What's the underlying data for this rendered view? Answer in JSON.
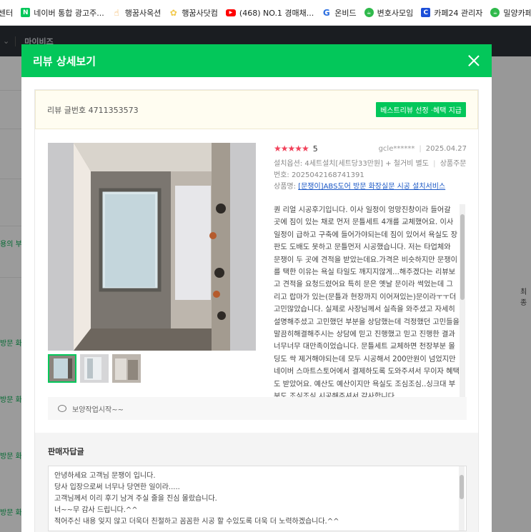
{
  "bookmarks": [
    {
      "label": "센터",
      "icon": "",
      "color": ""
    },
    {
      "label": "네이버 통합 광고주...",
      "icon": "naver-n-icon",
      "color": "#03c75a"
    },
    {
      "label": "행꿈사옥션",
      "icon": "hand-icon",
      "color": "#f0a030"
    },
    {
      "label": "행꿈사닷컴",
      "icon": "flower-icon",
      "color": "#f2c94c"
    },
    {
      "label": "(468) NO.1 경매채...",
      "icon": "youtube-icon",
      "color": "#ff0000"
    },
    {
      "label": "온비드",
      "icon": "onbid-g-icon",
      "color": "#2d6fe0"
    },
    {
      "label": "변호사모임",
      "icon": "cafe-icon",
      "color": "#2fb94b"
    },
    {
      "label": "카페24 관리자",
      "icon": "cafe24-c-icon",
      "color": "#1c4fd8"
    },
    {
      "label": "밀양카페",
      "icon": "cafe-icon",
      "color": "#2fb94b"
    }
  ],
  "background": {
    "nav_label": "마이비즈",
    "green_link": "용의 부",
    "col_header": "최종",
    "row_links": [
      "방문 화",
      "방문 화",
      "방문 화",
      "방문 화"
    ]
  },
  "modal": {
    "title": "리뷰 상세보기",
    "review_number": "리뷰 글번호 4711353573",
    "best_review_button": "베스트리뷰 선정 ·혜택 지급",
    "rating": {
      "stars": "★★★★★",
      "score": "5"
    },
    "user": "gcle******",
    "date": "2025.04.27",
    "option_line": "설치옵션: 4세트설치[세트당33만원] + 철거비 별도",
    "order_label": "상품주문",
    "order_number": "번호: 2025042168741391",
    "product_label": "상품명:",
    "product_name": "[문쟁이]ABS도어 방문 화장실문 시공 설치서비스",
    "review_text": "퀀 리얼 시공후기입니다. 이사 일정이 엉망진창이라 들어갈 곳에 짐이 있는 채로 먼저 문틀세트 4개를 교체했어요. 이사일정이 급하고 구축에 들어가야되는데 짐이 있어서 욕실도 장판도 도배도 못하고 문틀먼저 시공했습니다. 저는 타업체와 문쟁이 두 곳에 견적을 받았는데요.가격은 비슷하지만 문쟁이를 택한 이유는 욕실 타일도 깨지지않게...해주겠다는 리뷰보고 견적을 요청드렸어요 특히 문은 옛날 문이라 썩었는데 그리고 랍마가 있는(문틀과 현장까지 이어져있는)문이라ㅜㅜ더 고민많았습니다. 실제로 사장님께서 실측을 와주셨고 자세히 설명해주셨고 고민했던 부분을 상담했는데 걱정했던 고민들을 말끔히해결해주시는 상담에 믿고 진행했고 믿고 진행한 결과 너무너무 대만족이었습니다. 문틀세트 교체하면 천장부분 몰딩도 싹 제거해야되는데 모두 시공해서 200만원이 넘었지만 네이버 스마트스토어에서 결제하도록 도와주셔서 무이자 혜택도 받았어요. 예산도 예산이지만 욕실도 조심조심..싱크대 부분도 조심조심 시공해주셔서 감사합니다",
    "comment": "보양작업시작~~",
    "seller_title": "판매자답글",
    "seller_reply": [
      "안녕하세요 고객님 문쟁이 입니다.",
      "당사 입장으로써 너무나 당연한 일이라.....",
      "고객님께서 이리 후기 남겨 주실 줄을 진심 몰랐습니다.",
      "너~~무 감사 드립니다.^^",
      "적어주신 내용 잊지 않고 더욱더 친절하고 꼼꼼한 시공 할 수있도록 더욱 더 노력하겠습니다.^^"
    ],
    "thumbnails": [
      "photo-1",
      "photo-2",
      "photo-3"
    ],
    "accent_color": "#03c75a"
  }
}
